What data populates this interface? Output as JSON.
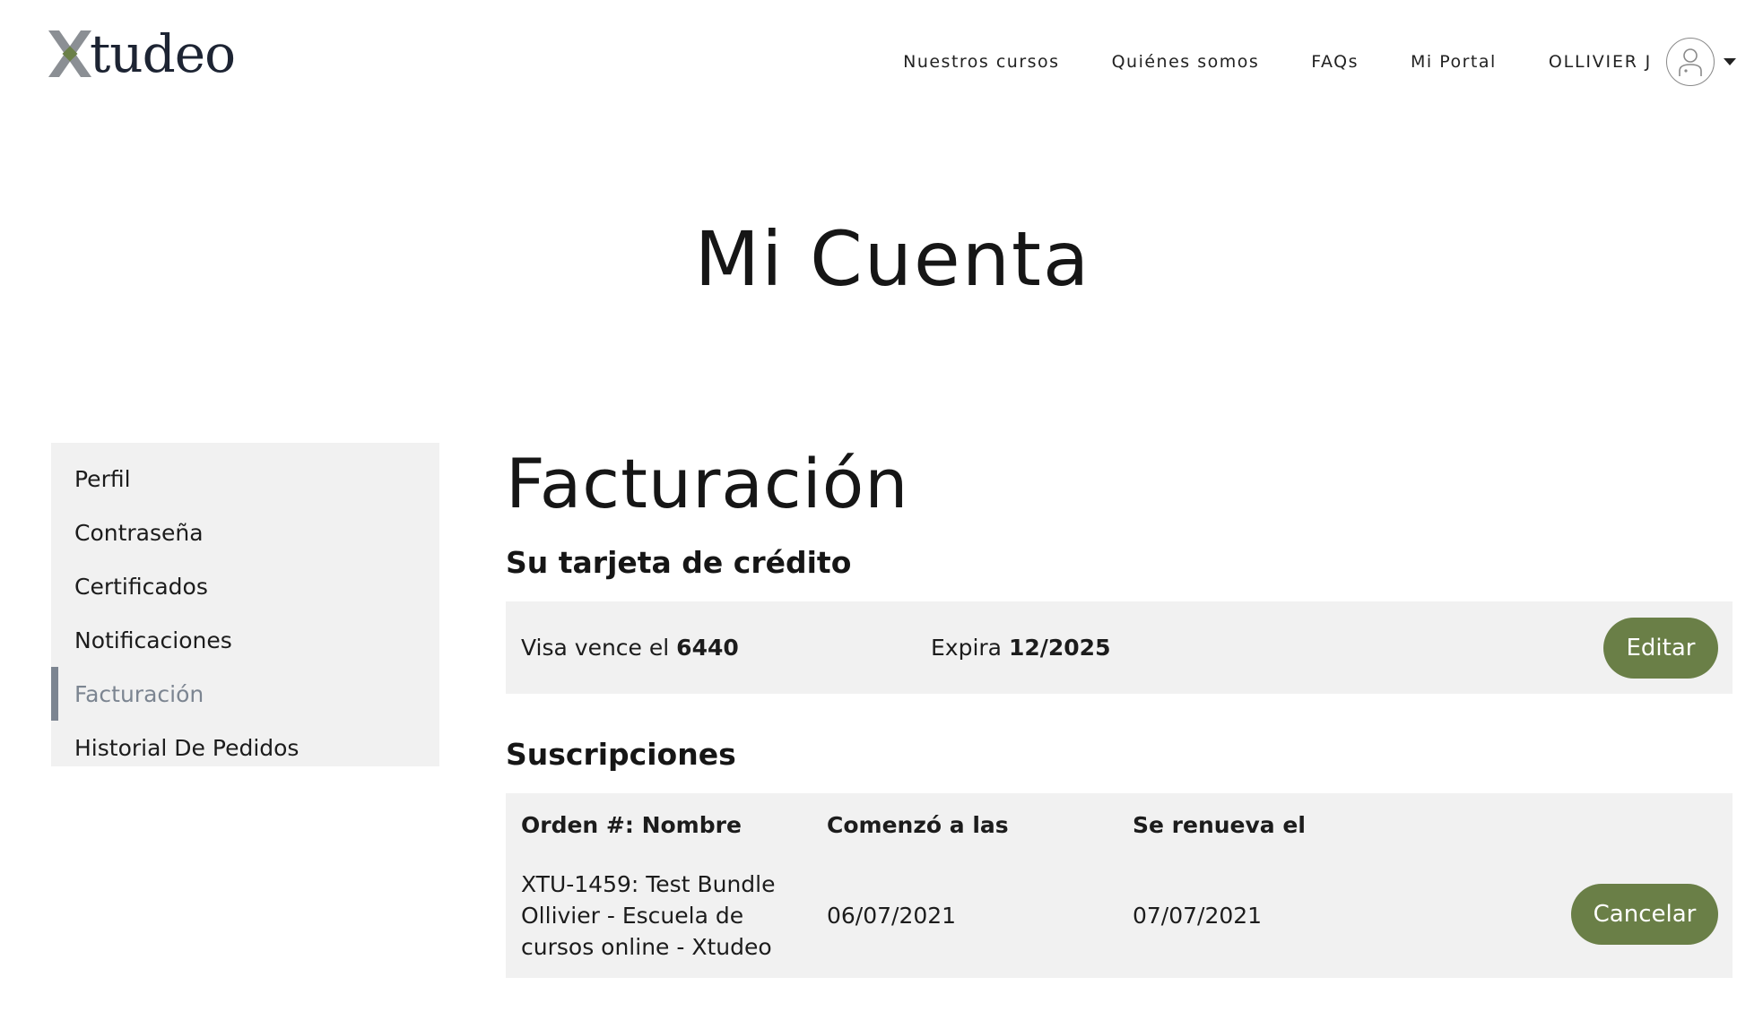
{
  "header": {
    "logo_text": "tudeo",
    "nav": [
      "Nuestros cursos",
      "Quiénes somos",
      "FAQs",
      "Mi Portal"
    ],
    "user_name": "OLLIVIER J",
    "colors": {
      "logo_x_gray": "#8b8f94",
      "logo_x_green": "#6a7f47"
    }
  },
  "page": {
    "title": "Mi Cuenta"
  },
  "sidebar": {
    "items": [
      {
        "label": "Perfil"
      },
      {
        "label": "Contraseña"
      },
      {
        "label": "Certificados"
      },
      {
        "label": "Notificaciones"
      },
      {
        "label": "Facturación"
      },
      {
        "label": "Historial De Pedidos"
      }
    ],
    "active": "Facturación"
  },
  "billing": {
    "title": "Facturación",
    "card_section_title": "Su tarjeta de crédito",
    "card_label": "Visa vence el",
    "card_last4": "6440",
    "expiry_label": "Expira",
    "expiry_value": "12/2025",
    "edit_button": "Editar"
  },
  "subscriptions": {
    "title": "Suscripciones",
    "columns": [
      "Orden #: Nombre",
      "Comenzó a las",
      "Se renueva el"
    ],
    "rows": [
      {
        "order_lines": [
          "XTU-1459: Test Bundle",
          "Ollivier - Escuela de",
          "cursos online - Xtudeo"
        ],
        "started": "06/07/2021",
        "renews": "07/07/2021",
        "action": "Cancelar"
      }
    ]
  },
  "theme": {
    "accent": "#6a7f47",
    "panel_bg": "#f1f1f1",
    "active_indicator": "#7c8591"
  }
}
